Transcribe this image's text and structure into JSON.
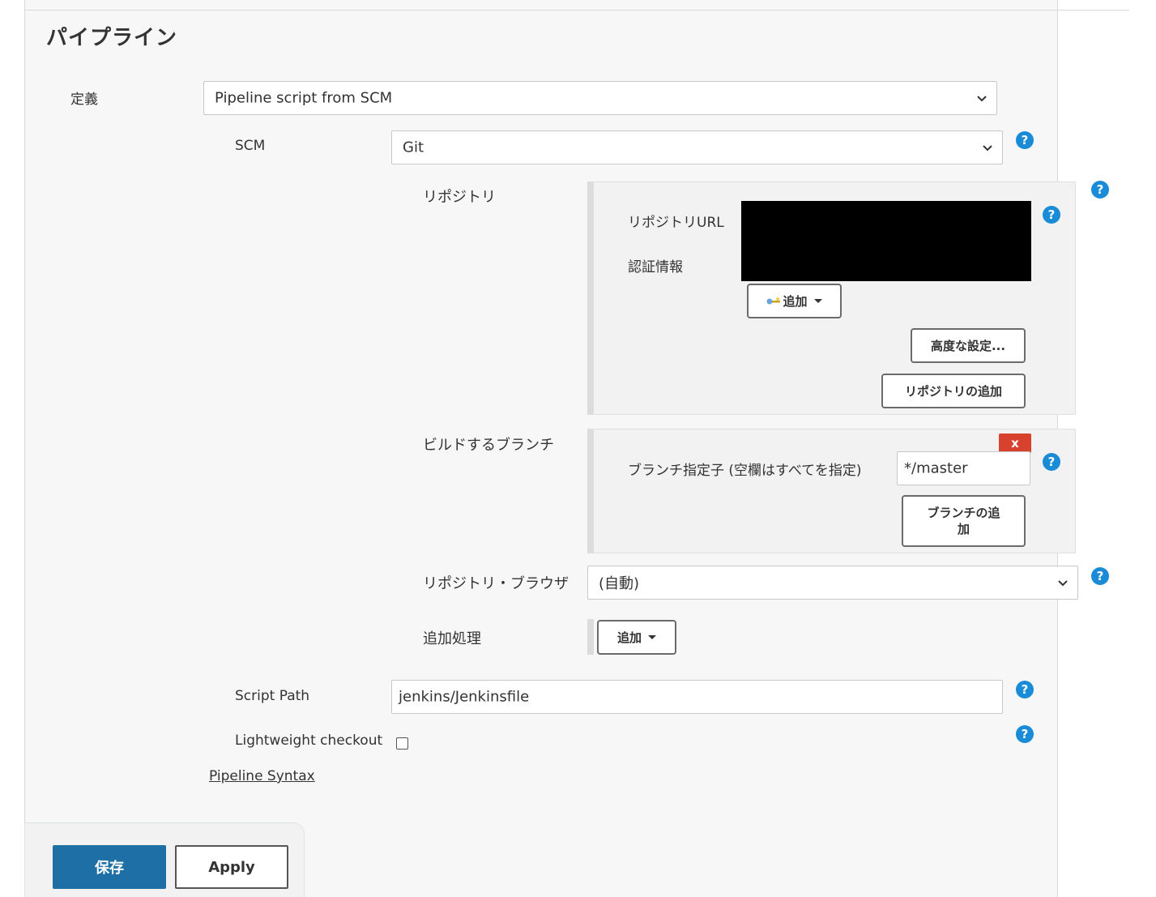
{
  "section": {
    "title": "パイプライン"
  },
  "definition": {
    "label": "定義",
    "value": "Pipeline script from SCM"
  },
  "scm": {
    "label": "SCM",
    "value": "Git"
  },
  "repository": {
    "label": "リポジトリ",
    "url_label": "リポジトリURL",
    "credentials_label": "認証情報",
    "add_button": "追加",
    "advanced_button": "高度な設定...",
    "add_repository_button": "リポジトリの追加"
  },
  "branches": {
    "label": "ビルドするブランチ",
    "delete_button": "x",
    "specifier_label": "ブランチ指定子 (空欄はすべてを指定)",
    "specifier_value": "*/master",
    "add_branch_button_line1": "ブランチの追",
    "add_branch_button_line2": "加"
  },
  "repository_browser": {
    "label": "リポジトリ・ブラウザ",
    "value": "(自動)"
  },
  "additional_behaviours": {
    "label": "追加処理",
    "add_button": "追加"
  },
  "script_path": {
    "label": "Script Path",
    "value": "jenkins/Jenkinsfile"
  },
  "lightweight_checkout": {
    "label": "Lightweight checkout",
    "checked": false
  },
  "pipeline_syntax_link": "Pipeline Syntax",
  "footer": {
    "save_button": "保存",
    "apply_button": "Apply"
  },
  "help_icon_glyph": "?",
  "colors": {
    "accent": "#1d6fa5",
    "help": "#1a8bd6",
    "danger": "#d9412f",
    "panel": "#f7f7f7"
  }
}
